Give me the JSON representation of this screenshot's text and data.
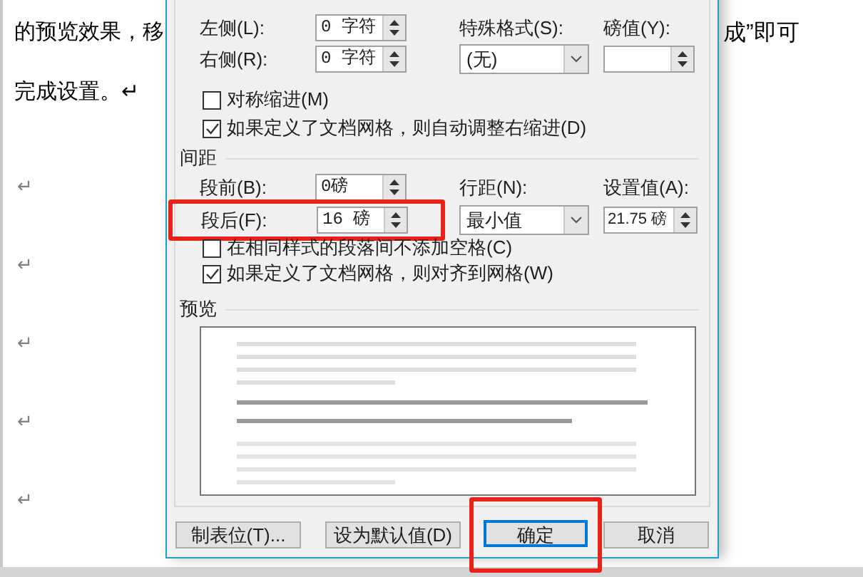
{
  "document": {
    "left_lines": [
      "的预览效果，移",
      "完成设置。↵",
      "↵",
      "↵",
      "↵",
      "↵",
      "↵"
    ],
    "right_fragment": "成”即可"
  },
  "dialog": {
    "indent": {
      "left": {
        "label": "左侧(L):",
        "value": "0 字符"
      },
      "right": {
        "label": "右侧(R):",
        "value": "0 字符"
      },
      "special": {
        "label": "特殊格式(S):",
        "value": "(无)"
      },
      "by": {
        "label": "磅值(Y):"
      }
    },
    "indent_options": [
      {
        "label": "对称缩进(M)",
        "checked": false
      },
      {
        "label": "如果定义了文档网格，则自动调整右缩进(D)",
        "checked": true
      }
    ],
    "spacing": {
      "title": "间距",
      "before": {
        "label": "段前(B):",
        "value": "0磅"
      },
      "after": {
        "label": "段后(F):",
        "value": "16 磅",
        "highlighted": true
      },
      "line_spacing": {
        "label": "行距(N):",
        "value": "最小值"
      },
      "at": {
        "label": "设置值(A):",
        "value": "21.75 磅"
      }
    },
    "spacing_options": [
      {
        "label": "在相同样式的段落间不添加空格(C)",
        "checked": false
      },
      {
        "label": "如果定义了文档网格，则对齐到网格(W)",
        "checked": true
      }
    ],
    "preview": {
      "title": "预览"
    },
    "buttons": [
      {
        "label": "制表位(T)...",
        "default": false,
        "highlighted": false
      },
      {
        "label": "设为默认值(D)",
        "default": false,
        "highlighted": false
      },
      {
        "label": "确定",
        "default": true,
        "highlighted": true
      },
      {
        "label": "取消",
        "default": false,
        "highlighted": false
      }
    ]
  }
}
